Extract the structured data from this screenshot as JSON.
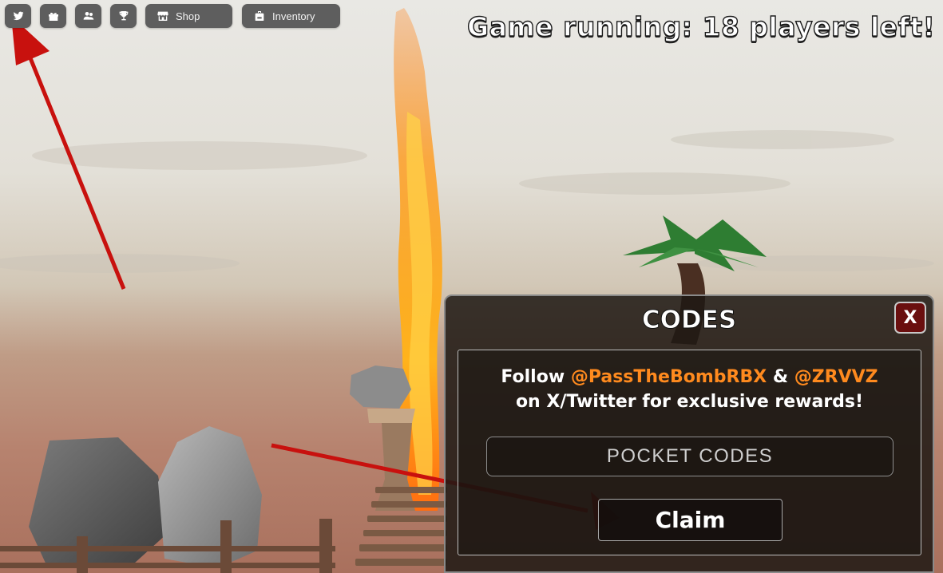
{
  "hud": {
    "icons": [
      "twitter-icon",
      "gift-icon",
      "friends-icon",
      "trophy-icon"
    ],
    "shop_label": "Shop",
    "inventory_label": "Inventory",
    "status_text": "Game running: 18 players left!"
  },
  "codes": {
    "title": "CODES",
    "close_label": "X",
    "follow_prefix": "Follow ",
    "handle_1": "@PassTheBombRBX",
    "follow_mid": " & ",
    "handle_2": "@ZRVVZ",
    "follow_line2": "on X/Twitter for exclusive rewards!",
    "input_placeholder": "POCKET CODES",
    "claim_label": "Claim"
  },
  "colors": {
    "accent_handle": "#ff8a1e",
    "close_button": "#6a0f0f",
    "hud_button": "#5e5e5e",
    "annotation_arrow": "#c8110e"
  }
}
